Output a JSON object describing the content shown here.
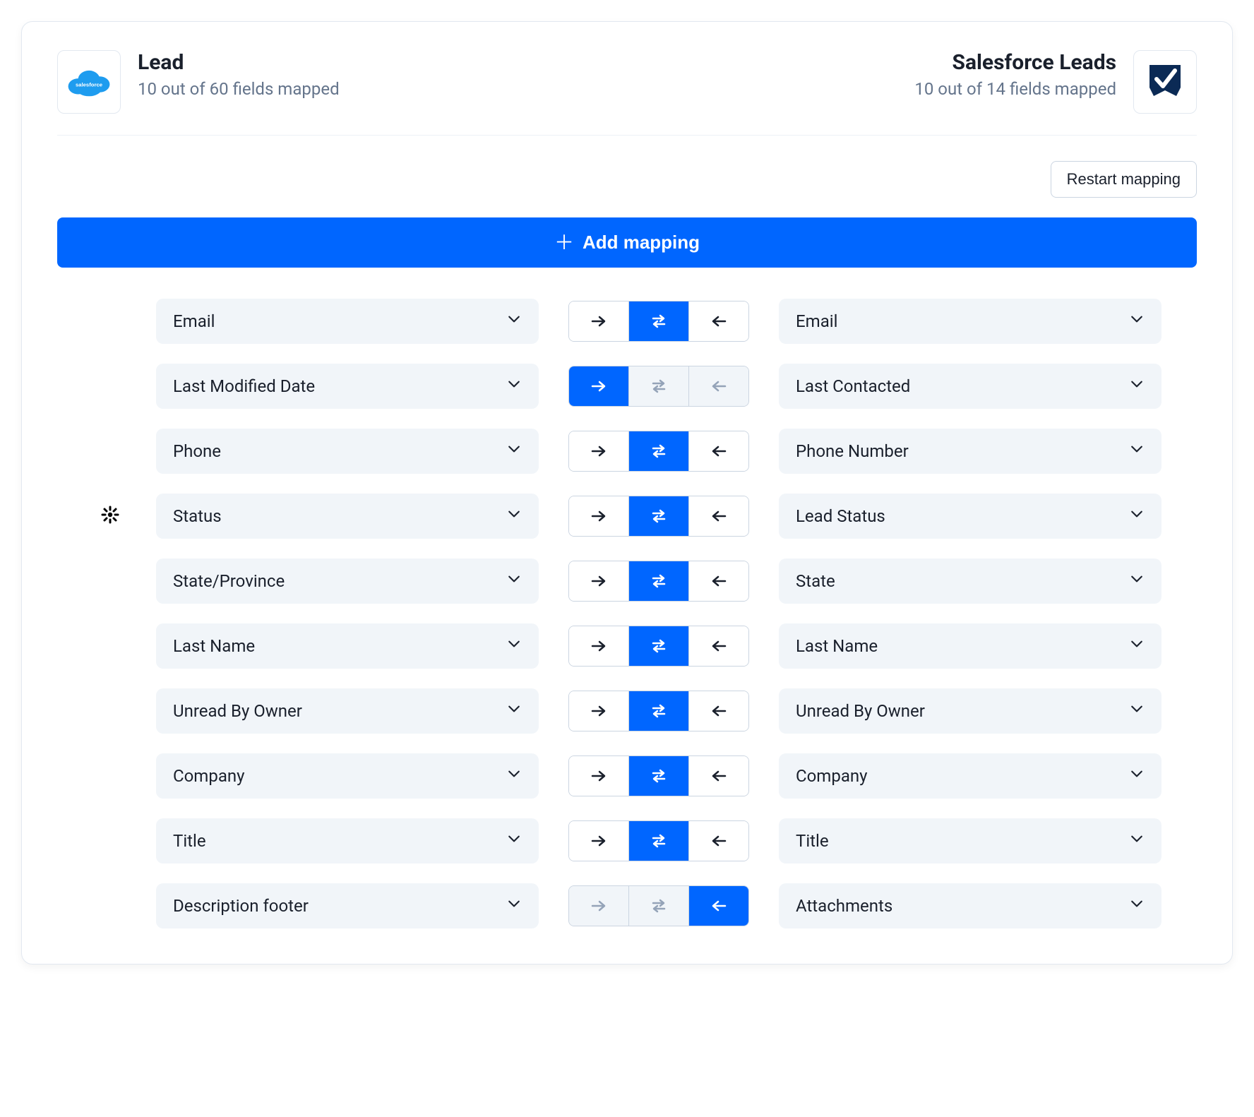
{
  "left_source": {
    "title": "Lead",
    "subtitle": "10 out of 60 fields mapped",
    "logo": "salesforce"
  },
  "right_source": {
    "title": "Salesforce Leads",
    "subtitle": "10 out of 14 fields mapped",
    "logo": "shield-check"
  },
  "toolbar": {
    "restart_label": "Restart mapping",
    "add_label": "Add mapping"
  },
  "mappings": [
    {
      "gear": false,
      "left": "Email",
      "right": "Email",
      "dir": "both",
      "disabled": []
    },
    {
      "gear": false,
      "left": "Last Modified Date",
      "right": "Last Contacted",
      "dir": "right",
      "disabled": [
        "both",
        "left"
      ]
    },
    {
      "gear": false,
      "left": "Phone",
      "right": "Phone Number",
      "dir": "both",
      "disabled": []
    },
    {
      "gear": true,
      "left": "Status",
      "right": "Lead Status",
      "dir": "both",
      "disabled": []
    },
    {
      "gear": false,
      "left": "State/Province",
      "right": "State",
      "dir": "both",
      "disabled": []
    },
    {
      "gear": false,
      "left": "Last Name",
      "right": "Last Name",
      "dir": "both",
      "disabled": []
    },
    {
      "gear": false,
      "left": "Unread By Owner",
      "right": "Unread By Owner",
      "dir": "both",
      "disabled": []
    },
    {
      "gear": false,
      "left": "Company",
      "right": "Company",
      "dir": "both",
      "disabled": []
    },
    {
      "gear": false,
      "left": "Title",
      "right": "Title",
      "dir": "both",
      "disabled": []
    },
    {
      "gear": false,
      "left": "Description footer",
      "right": "Attachments",
      "dir": "left",
      "disabled": [
        "right",
        "both"
      ]
    }
  ]
}
